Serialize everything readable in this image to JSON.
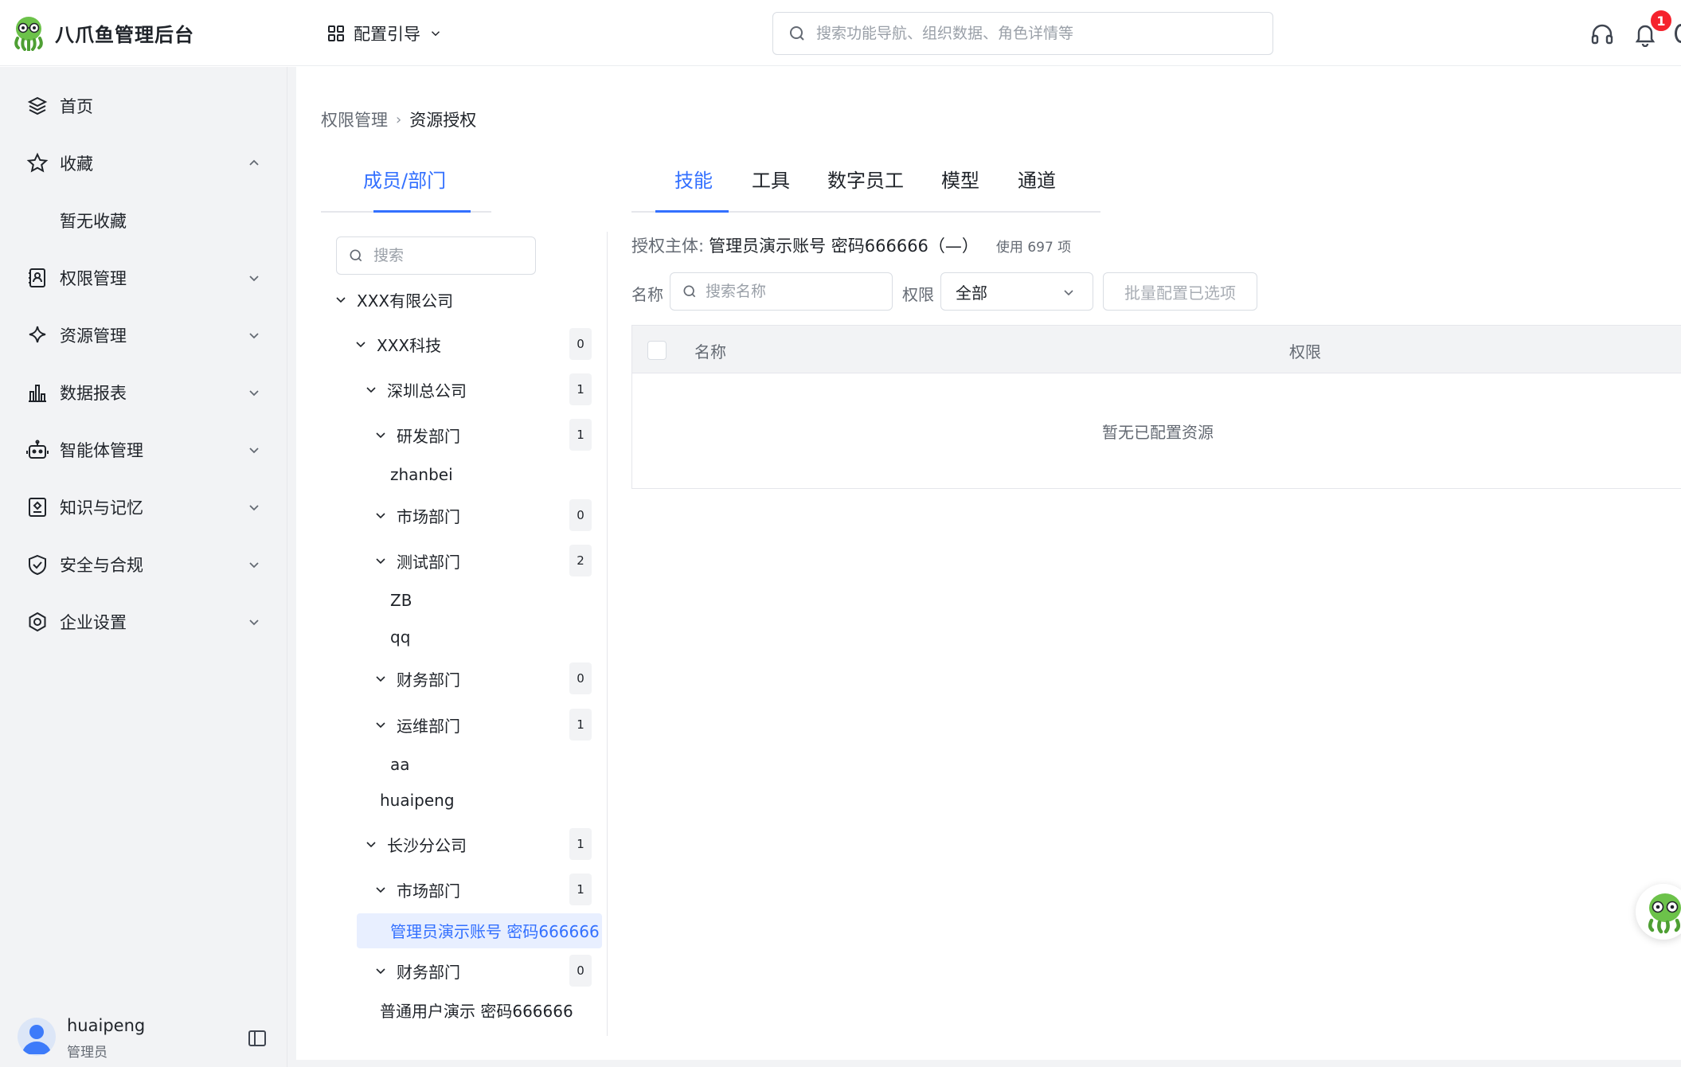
{
  "header": {
    "app_title": "八爪鱼管理后台",
    "guide_label": "配置引导",
    "search_placeholder": "搜索功能导航、组织数据、角色详情等",
    "notification_count": "1"
  },
  "sidebar": {
    "items": [
      {
        "label": "首页",
        "icon": "layers-icon"
      },
      {
        "label": "收藏",
        "icon": "star-icon"
      },
      {
        "label": "权限管理",
        "icon": "contact-book-icon"
      },
      {
        "label": "资源管理",
        "icon": "sparkle-icon"
      },
      {
        "label": "数据报表",
        "icon": "bar-chart-icon"
      },
      {
        "label": "智能体管理",
        "icon": "robot-icon"
      },
      {
        "label": "知识与记忆",
        "icon": "knowledge-icon"
      },
      {
        "label": "安全与合规",
        "icon": "shield-icon"
      },
      {
        "label": "企业设置",
        "icon": "hexagon-gear-icon"
      }
    ],
    "favorites_empty": "暂无收藏",
    "user": {
      "name": "huaipeng",
      "role": "管理员"
    }
  },
  "breadcrumb": [
    "权限管理",
    "资源授权"
  ],
  "member_panel": {
    "tab_label": "成员/部门",
    "search_placeholder": "搜索",
    "tree": [
      {
        "label": "XXX有限公司",
        "expanded": true
      },
      {
        "label": "XXX科技",
        "count": "0",
        "expanded": true
      },
      {
        "label": "深圳总公司",
        "count": "1",
        "expanded": true
      },
      {
        "label": "研发部门",
        "count": "1",
        "expanded": true
      },
      {
        "label": "zhanbei"
      },
      {
        "label": "市场部门",
        "count": "0",
        "expanded": true
      },
      {
        "label": "测试部门",
        "count": "2",
        "expanded": true
      },
      {
        "label": "ZB"
      },
      {
        "label": "qq"
      },
      {
        "label": "财务部门",
        "count": "0",
        "expanded": true
      },
      {
        "label": "运维部门",
        "count": "1",
        "expanded": true
      },
      {
        "label": "aa"
      },
      {
        "label": "huaipeng"
      },
      {
        "label": "长沙分公司",
        "count": "1",
        "expanded": true
      },
      {
        "label": "市场部门",
        "count": "1",
        "expanded": true
      },
      {
        "label": "管理员演示账号 密码666666",
        "selected": true
      },
      {
        "label": "财务部门",
        "count": "0",
        "expanded": true
      },
      {
        "label": "普通用户演示 密码666666"
      }
    ]
  },
  "resource_panel": {
    "tabs": [
      "技能",
      "工具",
      "数字员工",
      "模型",
      "通道"
    ],
    "active_tab": "技能",
    "subject_label": "授权主体:",
    "subject_value": "管理员演示账号 密码666666（—）",
    "subject_count": "使用 697 项",
    "name_label": "名称",
    "name_placeholder": "搜索名称",
    "perm_label": "权限",
    "perm_value": "全部",
    "batch_button": "批量配置已选项",
    "table": {
      "columns": [
        "名称",
        "权限"
      ],
      "empty_text": "暂无已配置资源"
    }
  },
  "colors": {
    "accent": "#3370ff",
    "sidebar_bg": "#f2f3f5",
    "badge": "#f5222d",
    "selected_bg": "#e8efff"
  }
}
